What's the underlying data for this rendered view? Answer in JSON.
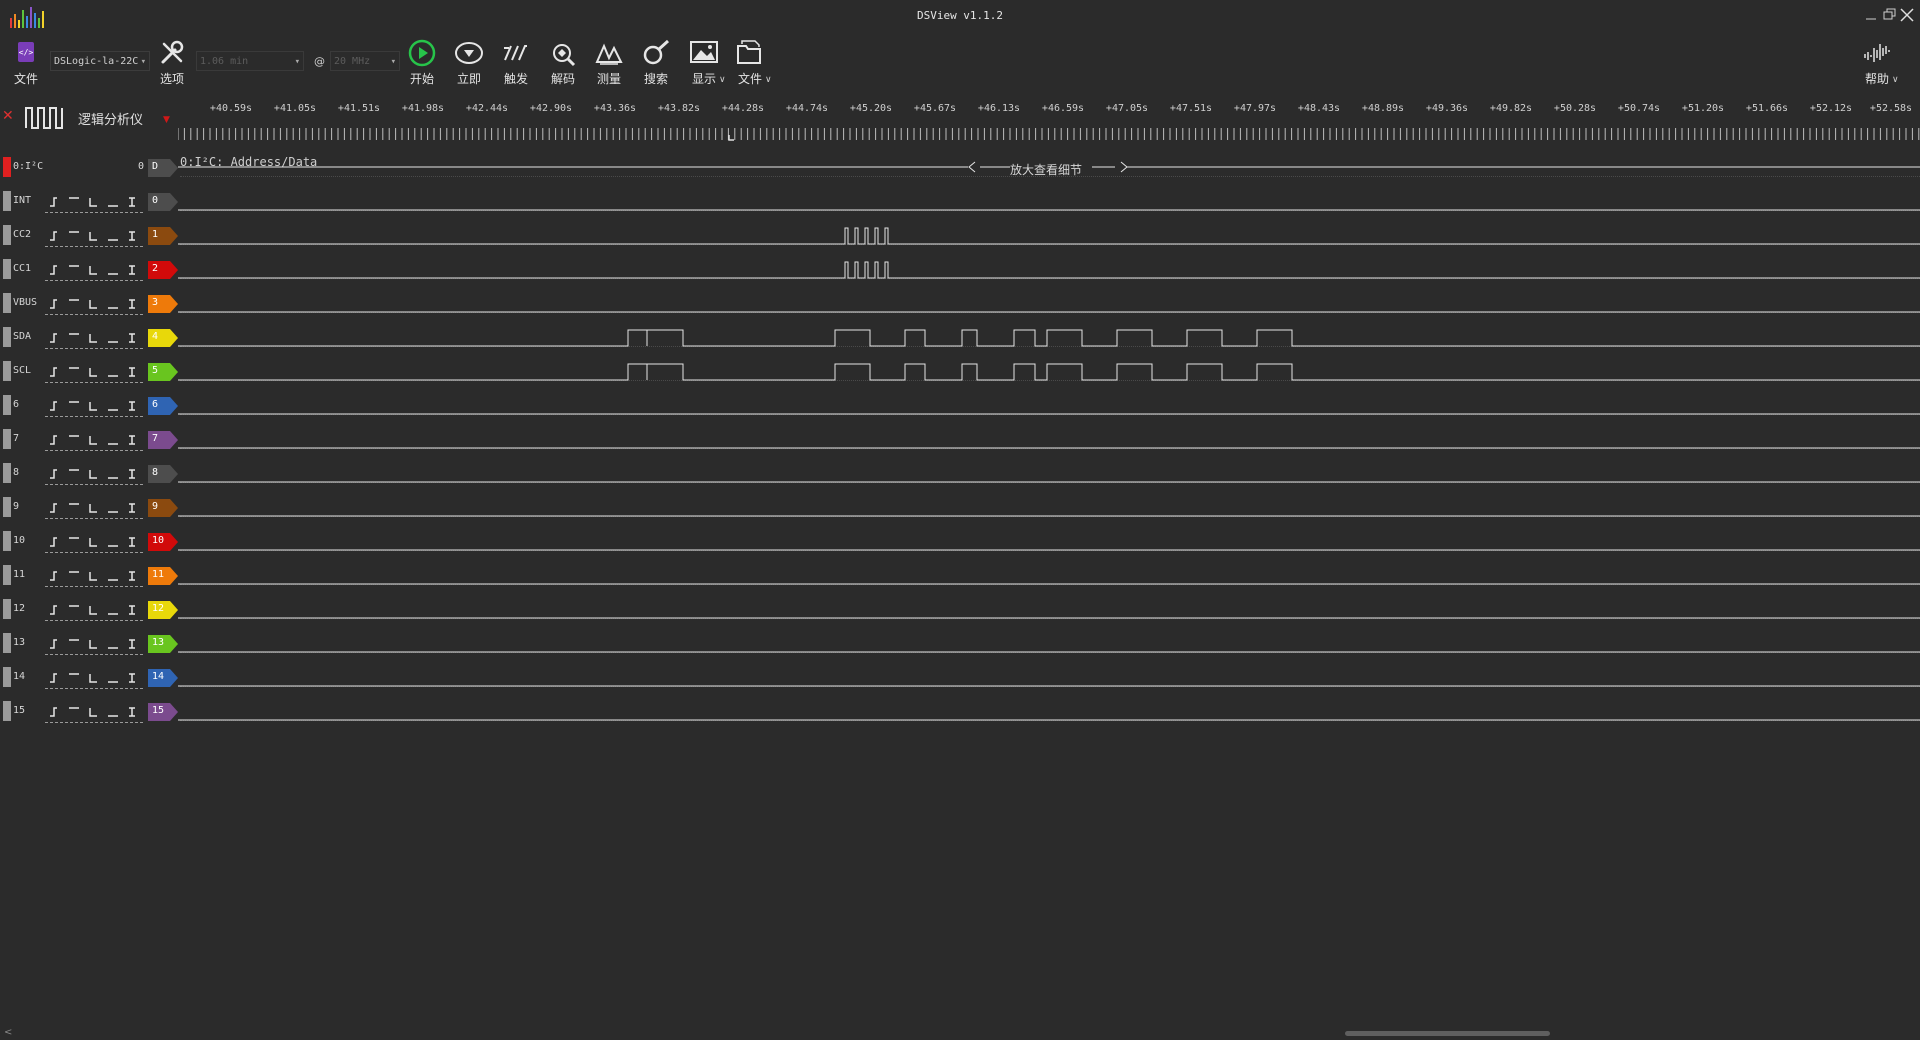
{
  "window": {
    "title": "DSView v1.1.2"
  },
  "toolbar": {
    "file_label": "文件",
    "device_select": "DSLogic-la-22C",
    "options_label": "选项",
    "duration_select": "1.06 min",
    "at_symbol": "@",
    "samplerate_select": "20 MHz",
    "start_label": "开始",
    "instant_label": "立即",
    "trigger_label": "触发",
    "decode_label": "解码",
    "measure_label": "测量",
    "search_label": "搜索",
    "display_label": "显示",
    "file2_label": "文件",
    "help_label": "帮助"
  },
  "colors": {
    "run_green": "#27c44a",
    "accent_purple": "#7a3db8",
    "channel_0": "#4d4d4d",
    "channel_1": "#8b4a0f",
    "channel_2": "#d10a0a",
    "channel_3": "#ee7a0a",
    "channel_4": "#e8d80a",
    "channel_5": "#69c51f",
    "channel_6": "#2f64b3",
    "channel_7": "#7b4b8e"
  },
  "analyzer": {
    "label": "逻辑分析仪"
  },
  "ruler": {
    "labels": [
      "+40.59s",
      "+41.05s",
      "+41.51s",
      "+41.98s",
      "+42.44s",
      "+42.90s",
      "+43.36s",
      "+43.82s",
      "+44.28s",
      "+44.74s",
      "+45.20s",
      "+45.67s",
      "+46.13s",
      "+46.59s",
      "+47.05s",
      "+47.51s",
      "+47.97s",
      "+48.43s",
      "+48.89s",
      "+49.36s",
      "+49.82s",
      "+50.28s",
      "+50.74s",
      "+51.20s",
      "+51.66s",
      "+52.12s",
      "+52.58s"
    ]
  },
  "decoder": {
    "name": "0:I²C",
    "badge_index": "0",
    "badge_letter": "D",
    "trace_label": "0:I²C: Address/Data",
    "zoom_hint": "放大查看细节"
  },
  "channels": [
    {
      "name": "INT",
      "num": "0",
      "color": "#4d4d4d"
    },
    {
      "name": "CC2",
      "num": "1",
      "color": "#8b4a0f"
    },
    {
      "name": "CC1",
      "num": "2",
      "color": "#d10a0a"
    },
    {
      "name": "VBUS",
      "num": "3",
      "color": "#ee7a0a"
    },
    {
      "name": "SDA",
      "num": "4",
      "color": "#e8d80a"
    },
    {
      "name": "SCL",
      "num": "5",
      "color": "#69c51f"
    },
    {
      "name": "6",
      "num": "6",
      "color": "#2f64b3"
    },
    {
      "name": "7",
      "num": "7",
      "color": "#7b4b8e"
    },
    {
      "name": "8",
      "num": "8",
      "color": "#4d4d4d"
    },
    {
      "name": "9",
      "num": "9",
      "color": "#8b4a0f"
    },
    {
      "name": "10",
      "num": "10",
      "color": "#d10a0a"
    },
    {
      "name": "11",
      "num": "11",
      "color": "#ee7a0a"
    },
    {
      "name": "12",
      "num": "12",
      "color": "#e8d80a"
    },
    {
      "name": "13",
      "num": "13",
      "color": "#69c51f"
    },
    {
      "name": "14",
      "num": "14",
      "color": "#2f64b3"
    },
    {
      "name": "15",
      "num": "15",
      "color": "#7b4b8e"
    }
  ]
}
